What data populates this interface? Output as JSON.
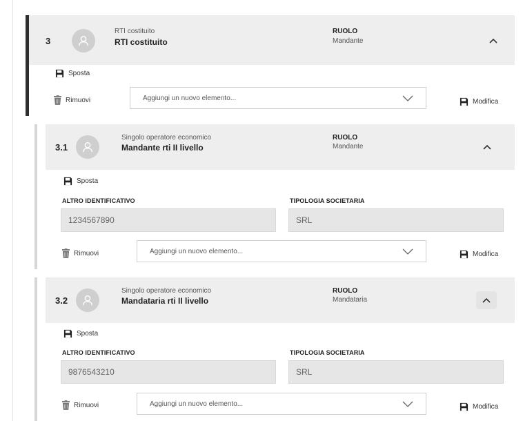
{
  "blocks": [
    {
      "number": "3",
      "subtype": "RTI costituito",
      "title": "RTI costituito",
      "role_label": "RUOLO",
      "role_value": "Mandante",
      "move_label": "Sposta",
      "remove_label": "Rimuovi",
      "select_placeholder": "Aggiungi un nuovo elemento...",
      "edit_label": "Modifica"
    },
    {
      "number": "3.1",
      "subtype": "Singolo operatore economico",
      "title": "Mandante rti II livello",
      "role_label": "RUOLO",
      "role_value": "Mandante",
      "move_label": "Sposta",
      "field1_label": "ALTRO IDENTIFICATIVO",
      "field1_value": "1234567890",
      "field2_label": "TIPOLOGIA SOCIETARIA",
      "field2_value": "SRL",
      "remove_label": "Rimuovi",
      "select_placeholder": "Aggiungi un nuovo elemento...",
      "edit_label": "Modifica"
    },
    {
      "number": "3.2",
      "subtype": "Singolo operatore economico",
      "title": "Mandataria rti II livello",
      "role_label": "RUOLO",
      "role_value": "Mandataria",
      "move_label": "Sposta",
      "field1_label": "ALTRO IDENTIFICATIVO",
      "field1_value": "9876543210",
      "field2_label": "TIPOLOGIA SOCIETARIA",
      "field2_value": "SRL",
      "remove_label": "Rimuovi",
      "select_placeholder": "Aggiungi un nuovo elemento...",
      "edit_label": "Modifica"
    }
  ],
  "icons": {
    "avatar": "user-avatar-icon",
    "move": "floppy-disk-icon",
    "remove": "trash-icon",
    "edit": "floppy-disk-icon",
    "collapse": "chevron-up-icon",
    "dropdown": "chevron-down-icon"
  },
  "colors": {
    "header_bg": "#eeeeee",
    "active_bar": "#2e2e2e",
    "nested_bar": "#d6d6d6",
    "field_bg": "#e6e6e6"
  }
}
